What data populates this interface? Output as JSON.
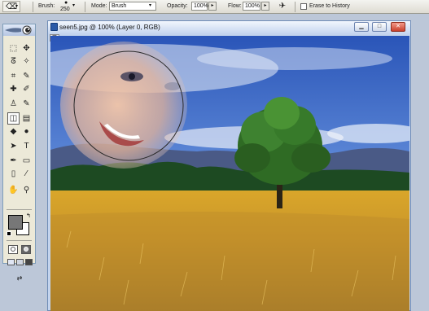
{
  "options_bar": {
    "brush_label": "Brush:",
    "brush_size": "250",
    "mode_label": "Mode:",
    "mode_value": "Brush",
    "opacity_label": "Opacity:",
    "opacity_value": "100%",
    "flow_label": "Flow:",
    "flow_value": "100%",
    "erase_history_label": "Erase to History",
    "erase_history_checked": false
  },
  "document": {
    "title": "seen5.jpg @ 100% (Layer 0, RGB)",
    "min_symbol": "▁",
    "max_symbol": "□",
    "close_symbol": "✕"
  },
  "toolbox": {
    "tools": [
      {
        "name": "marquee",
        "glyph": "⬚"
      },
      {
        "name": "move",
        "glyph": "✥"
      },
      {
        "name": "lasso",
        "glyph": "ᘔ"
      },
      {
        "name": "magic-wand",
        "glyph": "✧"
      },
      {
        "name": "crop",
        "glyph": "⌗"
      },
      {
        "name": "slice",
        "glyph": "✎"
      },
      {
        "name": "healing",
        "glyph": "✚"
      },
      {
        "name": "brush",
        "glyph": "✐"
      },
      {
        "name": "clone-stamp",
        "glyph": "♙"
      },
      {
        "name": "history-brush",
        "glyph": "✎"
      },
      {
        "name": "eraser",
        "glyph": "◫",
        "active": true
      },
      {
        "name": "gradient",
        "glyph": "▤"
      },
      {
        "name": "blur",
        "glyph": "◆"
      },
      {
        "name": "dodge",
        "glyph": "●"
      },
      {
        "name": "path-select",
        "glyph": "➤"
      },
      {
        "name": "type",
        "glyph": "T"
      },
      {
        "name": "pen",
        "glyph": "✒"
      },
      {
        "name": "shape",
        "glyph": "▭"
      },
      {
        "name": "notes",
        "glyph": "▯"
      },
      {
        "name": "eyedropper",
        "glyph": "⁄"
      },
      {
        "name": "hand",
        "glyph": "✋"
      },
      {
        "name": "zoom",
        "glyph": "⚲"
      }
    ],
    "foreground_color": "#777777",
    "background_color": "#ffffff"
  }
}
